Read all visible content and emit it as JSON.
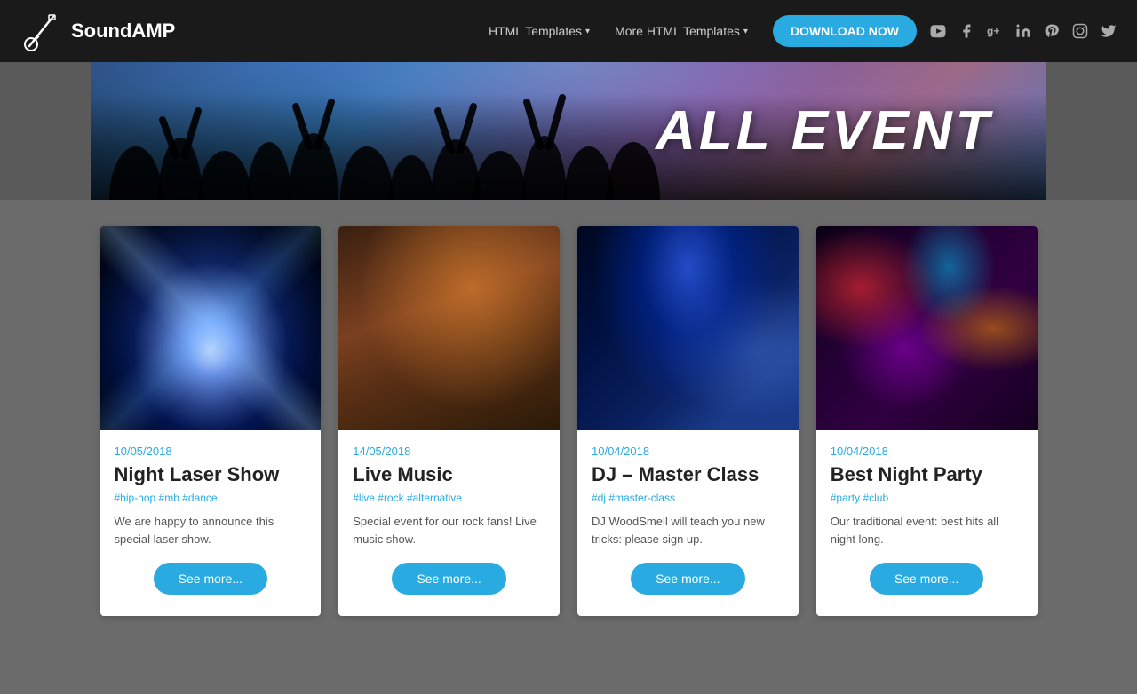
{
  "brand": {
    "name": "SoundAMP"
  },
  "nav": {
    "templates_label": "HTML Templates",
    "more_templates_label": "More HTML Templates",
    "download_label": "DOWNLOAD NOW",
    "social_icons": [
      "yt",
      "fb",
      "g+",
      "in",
      "pi",
      "ig",
      "tw"
    ]
  },
  "hero": {
    "title": "ALL EVENT"
  },
  "events": [
    {
      "date": "10/05/2018",
      "title": "Night Laser Show",
      "tags": "#hip-hop #mb #dance",
      "description": "We are happy to announce this special laser show.",
      "btn_label": "See more...",
      "image_class": "img-laser"
    },
    {
      "date": "14/05/2018",
      "title": "Live Music",
      "tags": "#live #rock #alternative",
      "description": "Special event for our rock fans! Live music show.",
      "btn_label": "See more...",
      "image_class": "img-music"
    },
    {
      "date": "10/04/2018",
      "title": "DJ – Master Class",
      "tags": "#dj #master-class",
      "description": "DJ WoodSmell will teach you new tricks: please sign up.",
      "btn_label": "See more...",
      "image_class": "img-dj"
    },
    {
      "date": "10/04/2018",
      "title": "Best Night Party",
      "tags": "#party #club",
      "description": "Our traditional event: best hits all night long.",
      "btn_label": "See more...",
      "image_class": "img-party"
    }
  ]
}
